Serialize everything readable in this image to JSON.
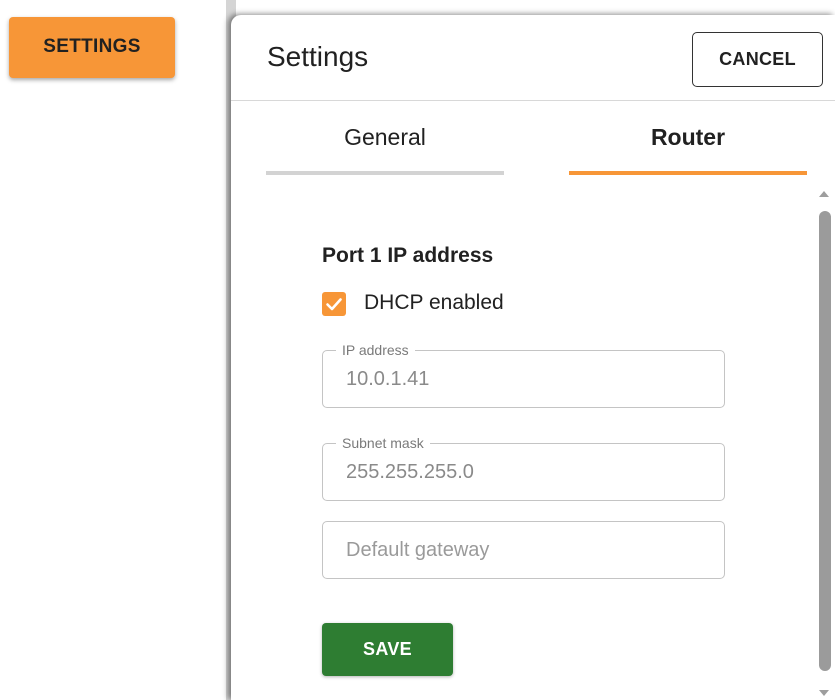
{
  "page": {
    "settings_button_label": "SETTINGS"
  },
  "modal": {
    "title": "Settings",
    "cancel_label": "CANCEL",
    "tabs": [
      {
        "label": "General",
        "active": false
      },
      {
        "label": "Router",
        "active": true
      }
    ],
    "router": {
      "section_title": "Port 1 IP address",
      "dhcp": {
        "label": "DHCP enabled",
        "checked": true
      },
      "ip_address": {
        "label": "IP address",
        "value": "10.0.1.41"
      },
      "subnet_mask": {
        "label": "Subnet mask",
        "value": "255.255.255.0"
      },
      "default_gateway": {
        "placeholder": "Default gateway",
        "value": ""
      },
      "save_label": "SAVE"
    }
  },
  "colors": {
    "accent": "#f79637",
    "save": "#2e7d32"
  },
  "icons": {
    "checkbox": "check-icon",
    "scroll_up": "chevron-up-icon",
    "scroll_down": "chevron-down-icon"
  }
}
